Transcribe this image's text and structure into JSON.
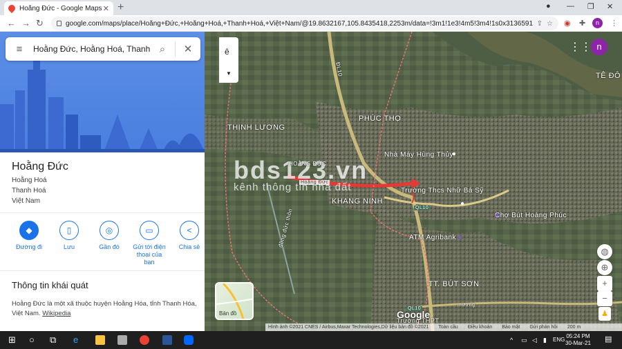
{
  "browser": {
    "tab_title": "Hoằng Đức - Google Maps",
    "tab_close": "✕",
    "new_tab": "+",
    "url": "google.com/maps/place/Hoằng+Đức,+Hoằng+Hoá,+Thanh+Hoá,+Việt+Nam/@19.8632167,105.8435418,2253m/data=!3m1!1e3!4m5!3m4!1s0x3136591111...",
    "profile_initial": "n"
  },
  "panel": {
    "search_value": "Hoằng Đức, Hoằng Hoá, Thanh Hoá",
    "place_title": "Hoằng Đức",
    "address_lines": [
      "Hoằng Hoá",
      "Thanh Hoá",
      "Việt Nam"
    ],
    "actions": [
      {
        "label": "Đường đi",
        "icon": "◆"
      },
      {
        "label": "Lưu",
        "icon": "▯"
      },
      {
        "label": "Gần đó",
        "icon": "◎"
      },
      {
        "label": "Gửi tới điện thoại của bạn",
        "icon": "▭"
      },
      {
        "label": "Chia sẻ",
        "icon": "<"
      }
    ],
    "overview_heading": "Thông tin khái quát",
    "overview_text": "Hoằng Đức là một xã thuộc huyện Hoằng Hóa, tỉnh Thanh Hóa, Việt Nam.",
    "overview_link": "Wikipedia"
  },
  "map": {
    "labels": {
      "thinh_luong": "THỊNH LƯƠNG",
      "phuc_tho": "PHÚC THỌ",
      "hoang_duc": "HOẰNG ĐỨC",
      "khang_ninh": "KHANG NINH",
      "tt_but_son": "TT. BÚT SƠN",
      "te_do": "TÊ ĐÔ",
      "nha_may": "Nhà Máy Hùng Thủy",
      "truong_thcs": "Trường Thcs Nhữ Bá Sỹ",
      "cho_but": "Chợ Bút Hoàng Phúc",
      "atm": "ATM Agribank",
      "ql10_a": "QL10",
      "ql10_b": "QL10",
      "road_dl10": "ĐL10",
      "road_dong_duc": "đồng đức thôn",
      "truong_thpt": "Trường THPT",
      "road_small": "Hoằng Đức",
      "muong": "mương"
    },
    "watermark_main": "bds123.vn",
    "watermark_sub": "kênh thông tin nhà đất",
    "layers_label": "Bản đồ",
    "google_logo": "Google",
    "footer": [
      "Hình ảnh ©2021 CNES / Airbus,Maxar Technologies,Dữ liệu bản đồ ©2021",
      "Toàn cầu",
      "Điều khoản",
      "Bảo mật",
      "Gửi phản hồi",
      "200 m"
    ]
  },
  "taskbar": {
    "lang": "ENG",
    "time": "05:24 PM",
    "date": "30-Mar-21"
  }
}
